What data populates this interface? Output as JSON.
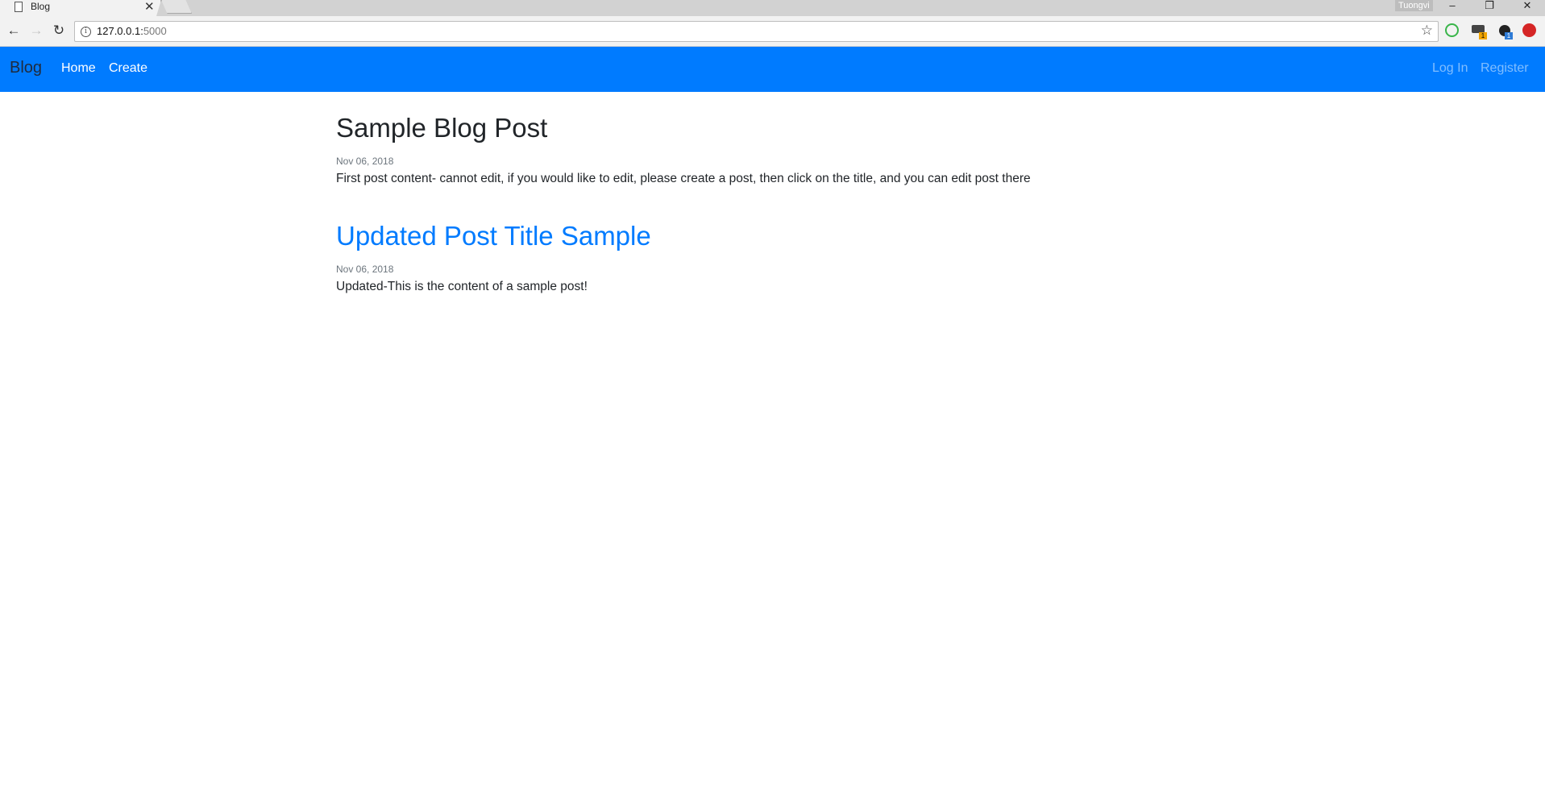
{
  "browser": {
    "tab_title": "Blog",
    "profile_name": "Tuongvi",
    "url_host": "127.0.0.1:",
    "url_port": "5000",
    "extension_badges": [
      "1",
      "1"
    ],
    "icons": [
      "document-icon",
      "close-icon",
      "back-icon",
      "forward-icon",
      "reload-icon",
      "info-icon",
      "star-icon",
      "minimize-icon",
      "maximize-icon",
      "window-close-icon"
    ]
  },
  "navbar": {
    "brand": "Blog",
    "links": [
      "Home",
      "Create"
    ],
    "auth_links": [
      "Log In",
      "Register"
    ],
    "background": "#007bff"
  },
  "posts": [
    {
      "title": "Sample Blog Post",
      "date": "Nov 06, 2018",
      "body": "First post content- cannot edit, if you would like to edit, please create a post, then click on the title, and you can edit post there"
    },
    {
      "title": "Updated Post Title Sample",
      "date": "Nov 06, 2018",
      "body": "Updated-This is the content of a sample post!"
    }
  ]
}
